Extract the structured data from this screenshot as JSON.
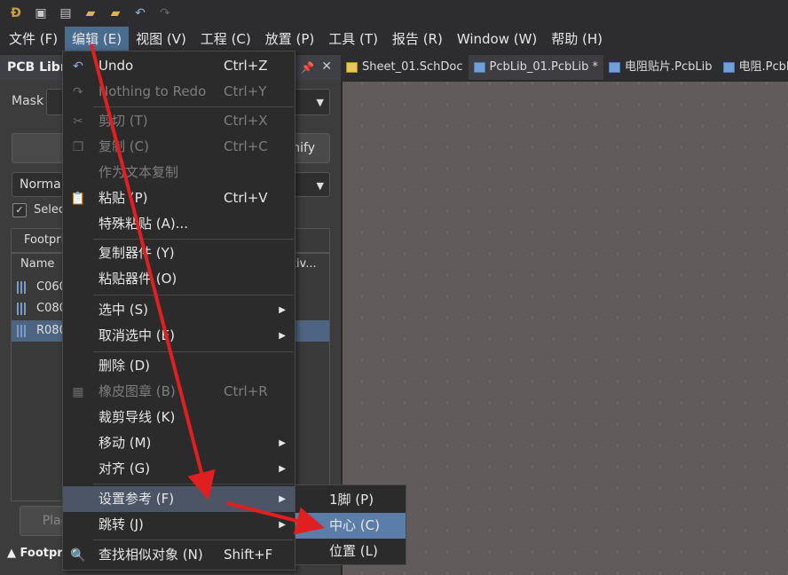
{
  "toolbar": {
    "icons": [
      "app-logo-icon",
      "save-icon",
      "save-all-icon",
      "open-folder-icon",
      "open-project-icon",
      "undo-icon",
      "redo-icon"
    ]
  },
  "menubar": {
    "items": [
      {
        "label": "文件 (F)"
      },
      {
        "label": "编辑 (E)"
      },
      {
        "label": "视图 (V)"
      },
      {
        "label": "工程 (C)"
      },
      {
        "label": "放置 (P)"
      },
      {
        "label": "工具 (T)"
      },
      {
        "label": "报告 (R)"
      },
      {
        "label": "Window (W)"
      },
      {
        "label": "帮助 (H)"
      }
    ]
  },
  "panel": {
    "title": "PCB Libra",
    "mask_label": "Mask",
    "btn_right": "nify",
    "normal_label": "Normal",
    "select_label": "Selec",
    "footprint_tab": "Footpri",
    "col_name": "Name",
    "col_right": "nitiv...",
    "rows": [
      "C060",
      "C080",
      "R080"
    ],
    "place_btn": "Plac",
    "bottom_tab": "Footpr"
  },
  "doctabs": [
    {
      "label": "Sheet_01.SchDoc",
      "type": "sch"
    },
    {
      "label": "PcbLib_01.PcbLib *",
      "type": "pcb"
    },
    {
      "label": "电阻贴片.PcbLib",
      "type": "pcb"
    },
    {
      "label": "电阻.PcbLib",
      "type": "pcb"
    }
  ],
  "edit_menu": {
    "items": [
      {
        "label": "Undo",
        "shortcut": "Ctrl+Z"
      },
      {
        "label": "Nothing to Redo",
        "shortcut": "Ctrl+Y"
      },
      {
        "label": "剪切 (T)",
        "shortcut": "Ctrl+X"
      },
      {
        "label": "复制 (C)",
        "shortcut": "Ctrl+C"
      },
      {
        "label": "作为文本复制",
        "shortcut": ""
      },
      {
        "label": "粘贴 (P)",
        "shortcut": "Ctrl+V"
      },
      {
        "label": "特殊粘贴 (A)...",
        "shortcut": ""
      },
      {
        "label": "复制器件 (Y)",
        "shortcut": ""
      },
      {
        "label": "粘贴器件 (O)",
        "shortcut": ""
      },
      {
        "label": "选中 (S)",
        "shortcut": ""
      },
      {
        "label": "取消选中 (E)",
        "shortcut": ""
      },
      {
        "label": "删除 (D)",
        "shortcut": ""
      },
      {
        "label": "橡皮图章 (B)",
        "shortcut": "Ctrl+R"
      },
      {
        "label": "裁剪导线 (K)",
        "shortcut": ""
      },
      {
        "label": "移动 (M)",
        "shortcut": ""
      },
      {
        "label": "对齐 (G)",
        "shortcut": ""
      },
      {
        "label": "设置参考 (F)",
        "shortcut": ""
      },
      {
        "label": "跳转 (J)",
        "shortcut": ""
      },
      {
        "label": "查找相似对象 (N)",
        "shortcut": "Shift+F"
      }
    ]
  },
  "set_reference_submenu": {
    "items": [
      {
        "label": "1脚 (P)"
      },
      {
        "label": "中心 (C)"
      },
      {
        "label": "位置 (L)"
      }
    ]
  },
  "colors": {
    "menu_highlight": "#4b5566",
    "submenu_highlight": "#5b7ea8",
    "annotation_arrow": "#e02020"
  }
}
